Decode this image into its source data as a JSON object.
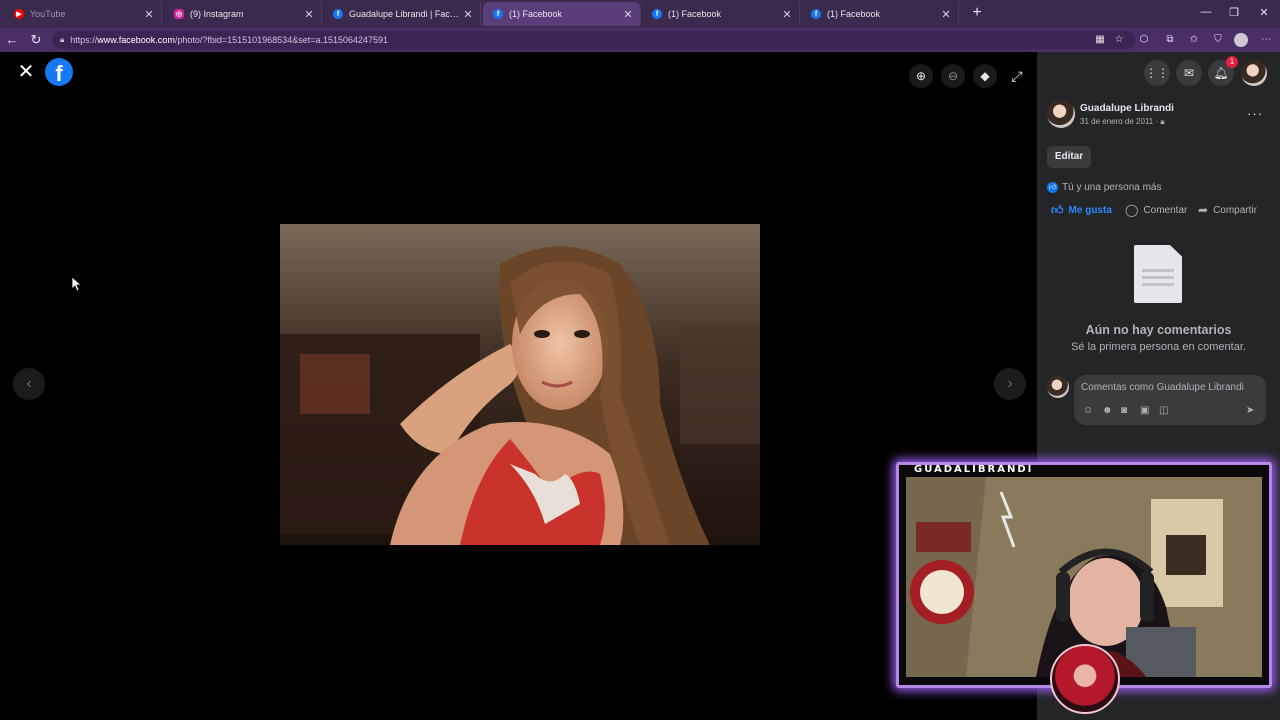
{
  "browser": {
    "tabs": [
      {
        "title": "YouTube",
        "favicon": "youtube-icon",
        "color": "#ff0000",
        "active": false
      },
      {
        "title": "(9) Instagram",
        "favicon": "instagram-icon",
        "color": "#d6249f",
        "active": false
      },
      {
        "title": "Guadalupe Librandi | Facebook",
        "favicon": "facebook-icon",
        "color": "#1877f2",
        "active": false
      },
      {
        "title": "(1) Facebook",
        "favicon": "facebook-icon",
        "color": "#1877f2",
        "active": true
      },
      {
        "title": "(1) Facebook",
        "favicon": "facebook-icon",
        "color": "#1877f2",
        "active": false
      },
      {
        "title": "(1) Facebook",
        "favicon": "facebook-icon",
        "color": "#1877f2",
        "active": false
      }
    ],
    "url_prefix": "https://",
    "url_host": "www.facebook.com",
    "url_path": "/photo/?fbid=1515101968534&set=a.1515064247591"
  },
  "viewer": {
    "logo_letter": "f"
  },
  "header": {
    "notification_count": "1"
  },
  "post": {
    "author": "Guadalupe Librandi",
    "date": "31 de enero de 2011 ·",
    "edit_label": "Editar",
    "reactions_text": "Tú y una persona más",
    "like_label": "Me gusta",
    "comment_label": "Comentar",
    "share_label": "Compartir",
    "no_comments_title": "Aún no hay comentarios",
    "no_comments_sub": "Sé la primera persona en comentar.",
    "comment_placeholder": "Comentas como Guadalupe Librandi"
  },
  "stream": {
    "channel_name": "GUADALIBRANDI"
  },
  "colors": {
    "facebook_blue": "#1877f2",
    "panel_bg": "#242526",
    "overlay_glow": "#9b5cf0"
  }
}
